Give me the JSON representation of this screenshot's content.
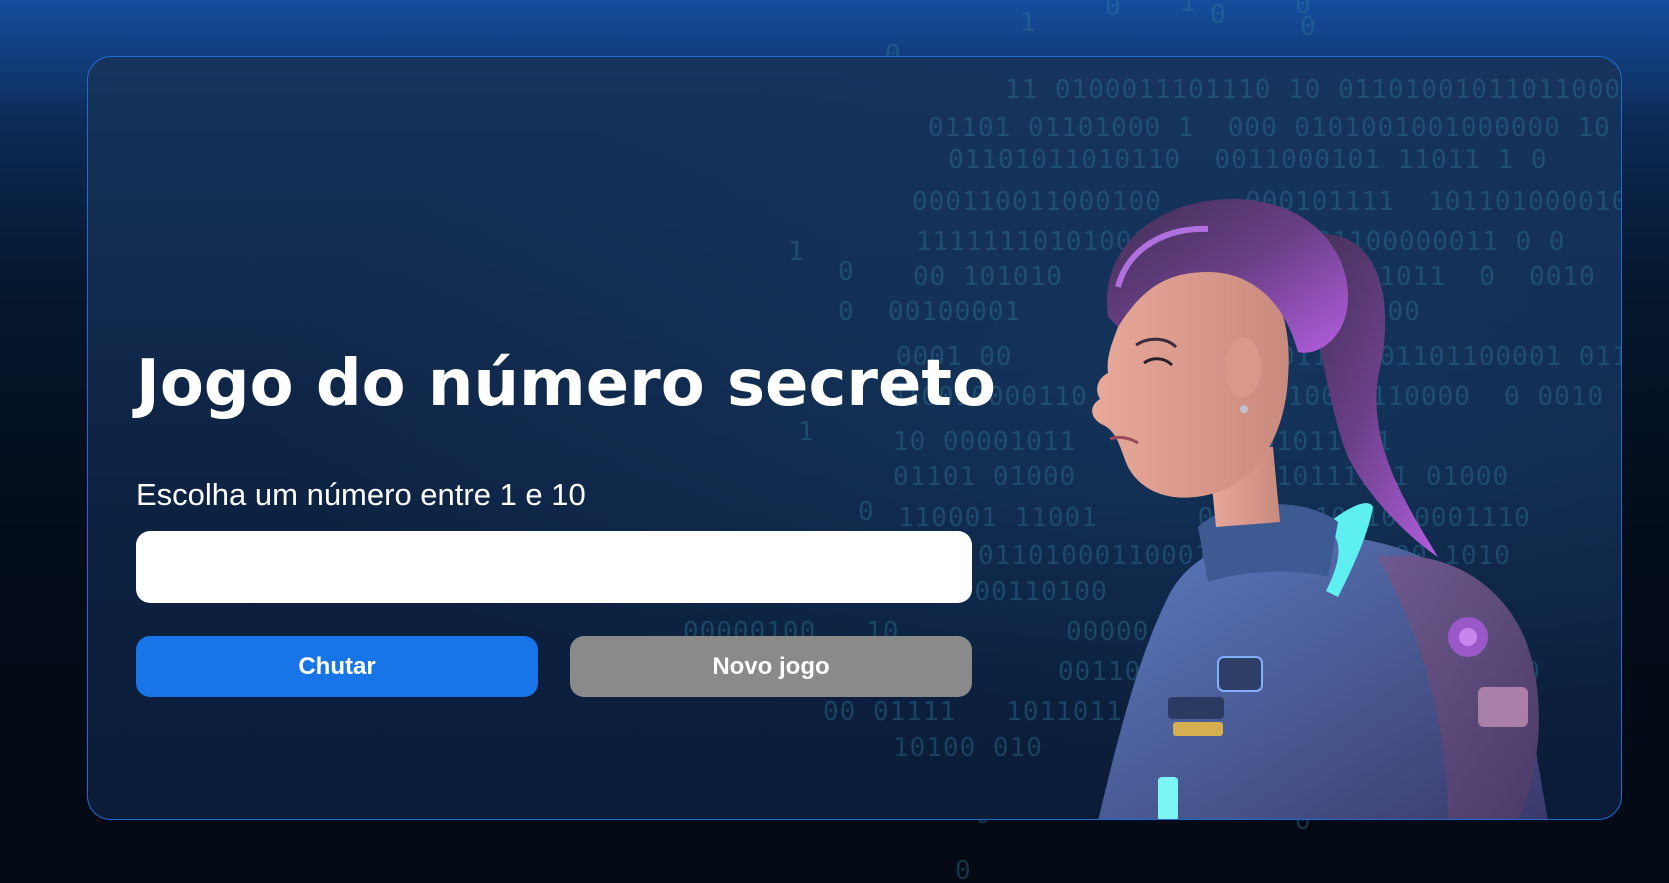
{
  "page": {
    "title": "Jogo do número secreto",
    "prompt": "Escolha um número entre 1 e 10"
  },
  "input": {
    "value": "",
    "placeholder": ""
  },
  "buttons": {
    "guess_label": "Chutar",
    "new_game_label": "Novo jogo"
  },
  "colors": {
    "accent": "#1875e8",
    "secondary_button": "#8a8a8a",
    "card_border": "#1f6bd6",
    "hair": "#b060d8",
    "suit": "#4a6ca8",
    "suit_glow": "#5ef0f0"
  },
  "illustration": {
    "icon": "woman-astronaut-illustration",
    "background_pattern": "binary-code-matrix"
  }
}
